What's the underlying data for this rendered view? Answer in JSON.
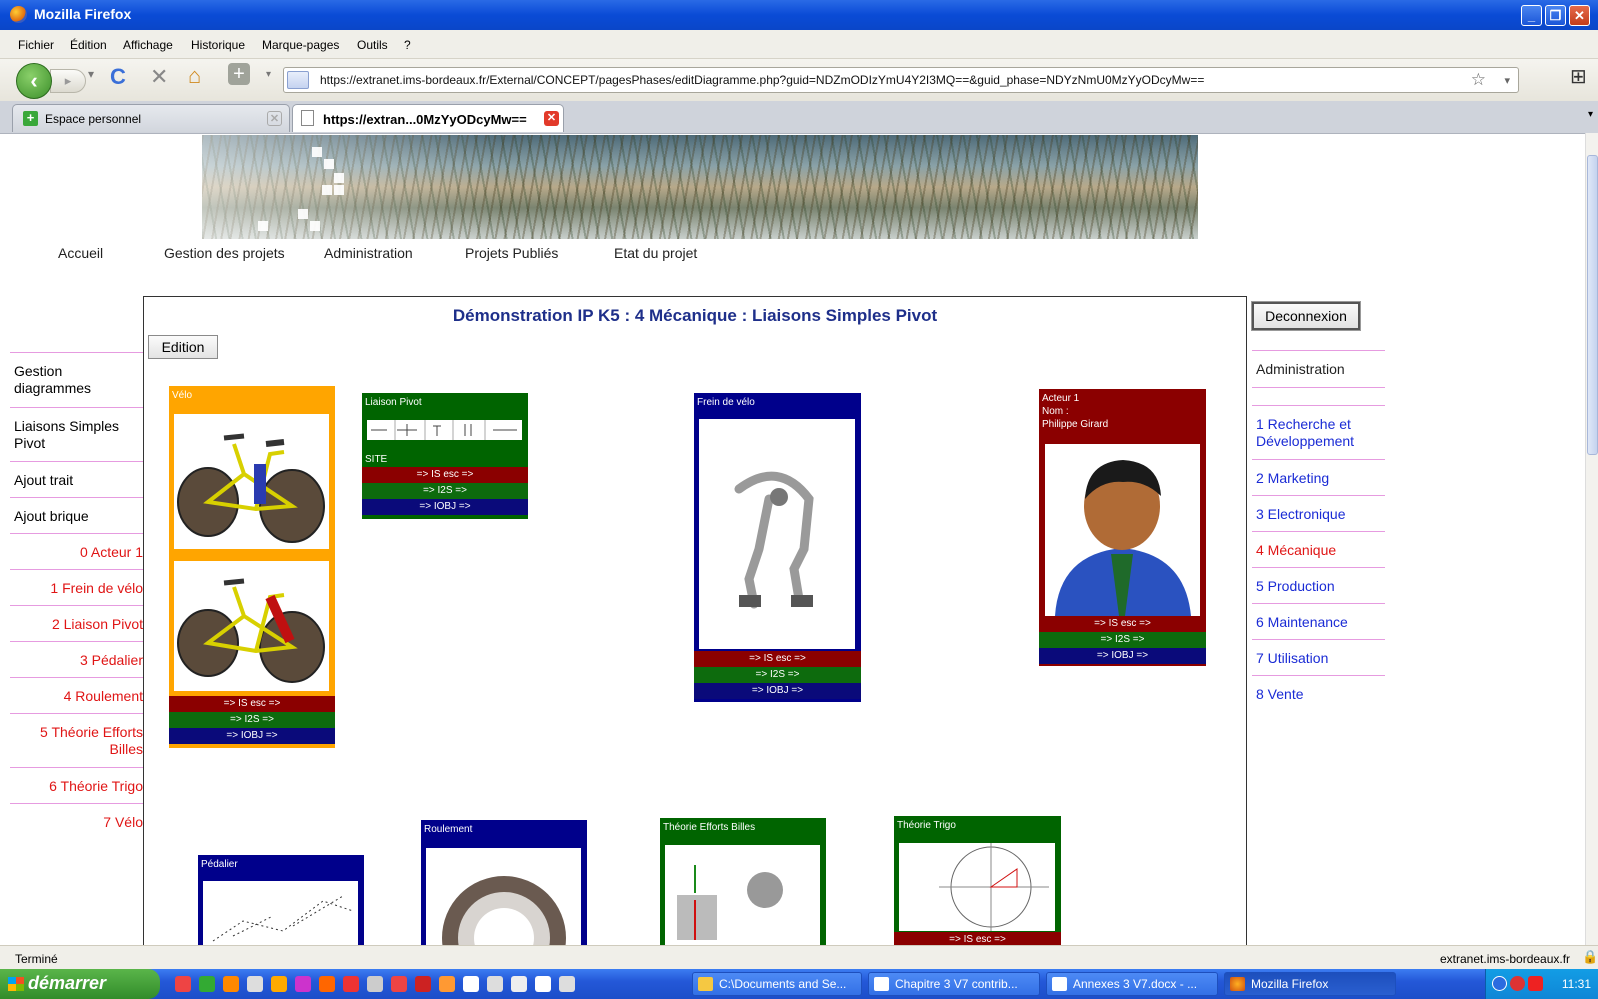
{
  "window": {
    "title": "Mozilla Firefox",
    "controls": [
      "_",
      "❐",
      "✕"
    ]
  },
  "menu": [
    "Fichier",
    "Édition",
    "Affichage",
    "Historique",
    "Marque-pages",
    "Outils",
    "?"
  ],
  "toolbar": {
    "url": "https://extranet.ims-bordeaux.fr/External/CONCEPT/pagesPhases/editDiagramme.php?guid=NDZmODIzYmU4Y2I3MQ==&guid_phase=NDYzNmU0MzYyODcyMw=="
  },
  "tabs": [
    {
      "label": "Espace personnel",
      "active": false
    },
    {
      "label": "https://extran...0MzYyODcyMw==",
      "active": true
    }
  ],
  "page": {
    "topnav": [
      "Accueil",
      "Gestion des projets",
      "Administration",
      "Projets Publiés",
      "Etat du projet"
    ],
    "title": "Démonstration IP K5 : 4 Mécanique : Liaisons Simples Pivot",
    "edit_button": "Edition",
    "logout_button": "Deconnexion",
    "left_nav_top": [
      "Gestion diagrammes",
      "Liaisons Simples Pivot",
      "Ajout trait",
      "Ajout brique"
    ],
    "left_nav_items": [
      "0 Acteur 1",
      "1 Frein de vélo",
      "2 Liaison Pivot",
      "3 Pédalier",
      "4 Roulement",
      "5 Théorie Efforts Billes",
      "6 Théorie Trigo",
      "7 Vélo"
    ],
    "right_nav_header": "Administration",
    "right_nav_items": [
      "1 Recherche et Développement",
      "2 Marketing",
      "3 Electronique",
      "4 Mécanique",
      "5 Production",
      "6 Maintenance",
      "7 Utilisation",
      "8 Vente"
    ],
    "right_nav_current": "4 Mécanique"
  },
  "bricks": {
    "bar_labels": [
      "=> IS esc =>",
      "=> I2S =>",
      "=> IOBJ =>"
    ],
    "velo": {
      "title": "Vélo",
      "color": "#ffa500"
    },
    "liaison": {
      "title": "Liaison Pivot",
      "site": "SITE",
      "color": "#006400"
    },
    "frein": {
      "title": "Frein de vélo",
      "color": "#00008b"
    },
    "acteur": {
      "title": "Acteur 1",
      "nom": "Nom :",
      "person": "Philippe Girard",
      "color": "#8b0000"
    },
    "pedalier": {
      "title": "Pédalier",
      "color": "#00008b"
    },
    "roulement": {
      "title": "Roulement",
      "color": "#00008b"
    },
    "efforts": {
      "title": "Théorie Efforts Billes",
      "color": "#006400"
    },
    "trigo": {
      "title": "Théorie Trigo",
      "color": "#006400"
    }
  },
  "status": {
    "left": "Terminé",
    "right": "extranet.ims-bordeaux.fr"
  },
  "taskbar": {
    "start": "démarrer",
    "tasks": [
      "C:\\Documents and Se...",
      "Chapitre 3 V7 contrib...",
      "Annexes 3 V7.docx - ...",
      "Mozilla Firefox"
    ],
    "clock": "11:31"
  }
}
